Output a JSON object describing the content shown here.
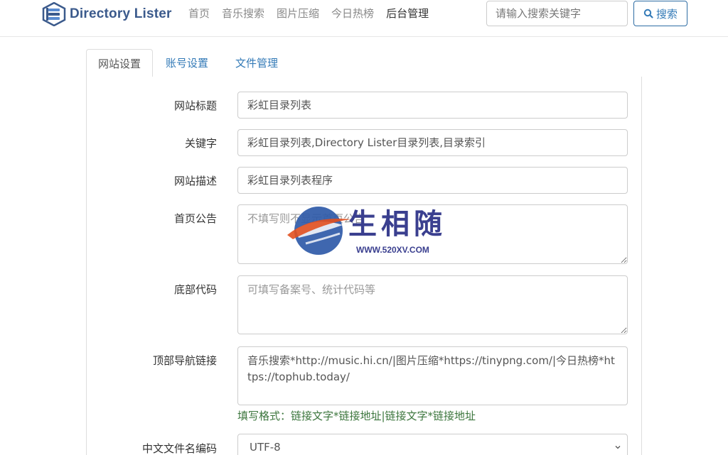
{
  "header": {
    "brand": "Directory Lister",
    "nav": [
      "首页",
      "音乐搜索",
      "图片压缩",
      "今日热榜",
      "后台管理"
    ],
    "search_placeholder": "请输入搜索关键字",
    "search_button": "搜索"
  },
  "tabs": [
    "网站设置",
    "账号设置",
    "文件管理"
  ],
  "form": {
    "title_label": "网站标题",
    "title_value": "彩虹目录列表",
    "keywords_label": "关键字",
    "keywords_value": "彩虹目录列表,Directory Lister目录列表,目录索引",
    "description_label": "网站描述",
    "description_value": "彩虹目录列表程序",
    "notice_label": "首页公告",
    "notice_placeholder": "不填写则不显示首页公告",
    "footer_label": "底部代码",
    "footer_placeholder": "可填写备案号、统计代码等",
    "topnav_label": "顶部导航链接",
    "topnav_value": "音乐搜索*http://music.hi.cn/|图片压缩*https://tinypng.com/|今日热榜*https://tophub.today/",
    "topnav_help": "填写格式：链接文字*链接地址|链接文字*链接地址",
    "encoding_label": "中文文件名编码",
    "encoding_value": "UTF-8"
  },
  "watermark": {
    "text": "生相随",
    "url": "WWW.520XV.COM"
  }
}
